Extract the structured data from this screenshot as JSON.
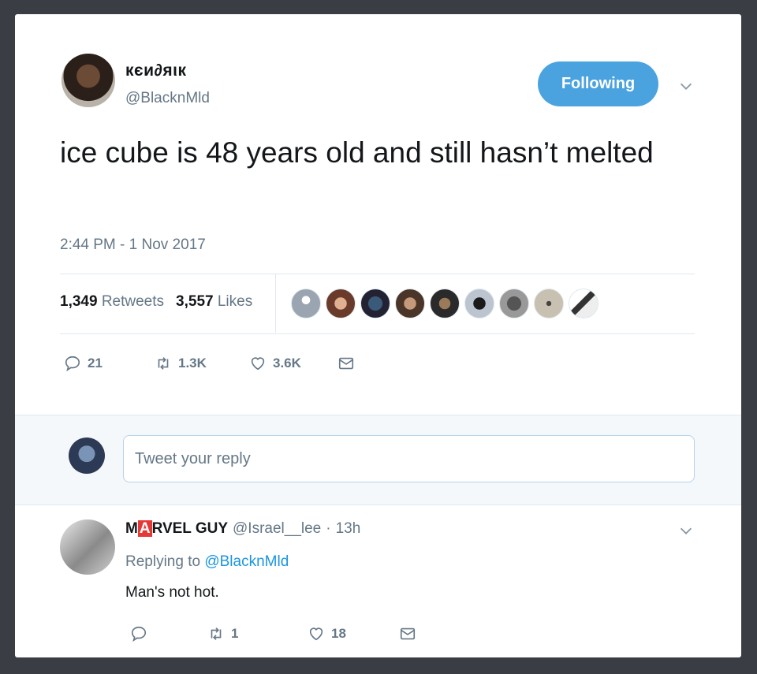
{
  "tweet": {
    "display_name": "кєи∂яιк",
    "handle": "@BlacknMld",
    "follow_button": "Following",
    "text": "ice cube is 48 years old and still hasn’t melted",
    "timestamp": "2:44 PM - 1 Nov 2017",
    "retweets_count": "1,349",
    "retweets_label": "Retweets",
    "likes_count": "3,557",
    "likes_label": "Likes",
    "liker_avatar_count": 9,
    "actions": {
      "reply_count": "21",
      "retweet_count": "1.3K",
      "like_count": "3.6K"
    }
  },
  "reply_box": {
    "placeholder": "Tweet your reply"
  },
  "reply": {
    "name_prefix": "M",
    "name_boxed": "A",
    "name_suffix": "RVEL GUY",
    "handle": "@Israel__lee",
    "separator": "·",
    "time": "13h",
    "replying_label": "Replying to",
    "replying_handle": "@BlacknMld",
    "text": "Man's not hot.",
    "actions": {
      "retweet_count": "1",
      "like_count": "18"
    }
  },
  "colors": {
    "accent": "#4aa3df",
    "link": "#1b95e0",
    "muted": "#657786"
  },
  "icons": [
    "chevron-down-icon",
    "reply-icon",
    "retweet-icon",
    "heart-icon",
    "envelope-icon"
  ]
}
